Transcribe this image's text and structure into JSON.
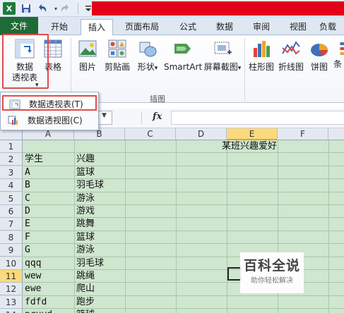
{
  "quick_access": {
    "app_icon": "excel-x-icon",
    "save_icon": "save-icon",
    "undo_icon": "undo-icon",
    "redo_icon": "redo-icon",
    "more_icon": "customize-toolbar-icon",
    "app_logo_text": "X"
  },
  "tabs": [
    {
      "label": "文件"
    },
    {
      "label": "开始"
    },
    {
      "label": "插入"
    },
    {
      "label": "页面布局"
    },
    {
      "label": "公式"
    },
    {
      "label": "数据"
    },
    {
      "label": "审阅"
    },
    {
      "label": "视图"
    },
    {
      "label": "负载"
    }
  ],
  "ribbon": {
    "pivot": {
      "line1": "数据",
      "line2": "透视表",
      "arrow": "▾"
    },
    "table": {
      "label": "表格"
    },
    "picture": {
      "label": "图片"
    },
    "clipart": {
      "label": "剪贴画"
    },
    "shapes": {
      "label": "形状",
      "arrow": "▾"
    },
    "smartart": {
      "label": "SmartArt"
    },
    "screenshot": {
      "label": "屏幕截图",
      "arrow": "▾"
    },
    "bar_chart": {
      "label": "柱形图"
    },
    "line_chart": {
      "label": "折线图"
    },
    "pie_chart": {
      "label": "饼图"
    },
    "more_chart": {
      "label": "条"
    },
    "group_illustrations": "插图"
  },
  "dropdown": {
    "item1": "数据透视表(T)",
    "item2": "数据透视图(C)"
  },
  "formula_bar": {
    "fx": "fx",
    "namebox_arrow": "▼"
  },
  "columns": [
    "A",
    "B",
    "C",
    "D",
    "E",
    "F"
  ],
  "rows": [
    {
      "n": "1",
      "a": "",
      "b": "",
      "e": "某班兴趣爱好"
    },
    {
      "n": "2",
      "a": "学生",
      "b": "兴趣"
    },
    {
      "n": "3",
      "a": "A",
      "b": "篮球"
    },
    {
      "n": "4",
      "a": "B",
      "b": "羽毛球"
    },
    {
      "n": "5",
      "a": "C",
      "b": "游泳"
    },
    {
      "n": "6",
      "a": "D",
      "b": "游戏"
    },
    {
      "n": "7",
      "a": "E",
      "b": "跳舞"
    },
    {
      "n": "8",
      "a": "F",
      "b": "篮球"
    },
    {
      "n": "9",
      "a": "G",
      "b": "游泳"
    },
    {
      "n": "10",
      "a": "qqq",
      "b": "羽毛球"
    },
    {
      "n": "11",
      "a": "wew",
      "b": "跳绳"
    },
    {
      "n": "12",
      "a": "ewe",
      "b": "爬山"
    },
    {
      "n": "13",
      "a": "fdfd",
      "b": "跑步"
    },
    {
      "n": "14",
      "a": "pruyd",
      "b": "篮球"
    }
  ],
  "watermark": {
    "title": "百科全说",
    "subtitle": "助你轻松解决"
  },
  "colors": {
    "accent": "#1f6b36",
    "highlight": "#e04b4b",
    "grid_fill": "#cfe6cf",
    "title_red": "#e3001b"
  }
}
